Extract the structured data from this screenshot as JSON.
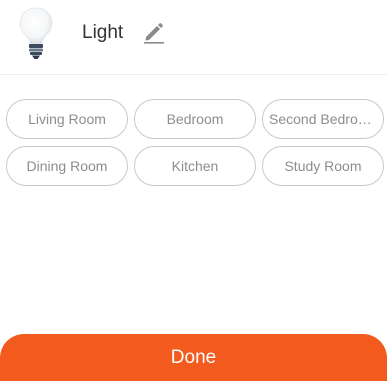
{
  "header": {
    "title": "Light",
    "icon": "lightbulb-icon",
    "edit_icon": "pencil-icon"
  },
  "rooms": [
    "Living Room",
    "Bedroom",
    "Second Bedroom",
    "Dining Room",
    "Kitchen",
    "Study Room"
  ],
  "footer": {
    "done_label": "Done"
  },
  "colors": {
    "accent": "#f25a1e",
    "chip_border": "#c9c9c9",
    "chip_text": "#8d8d8d"
  }
}
